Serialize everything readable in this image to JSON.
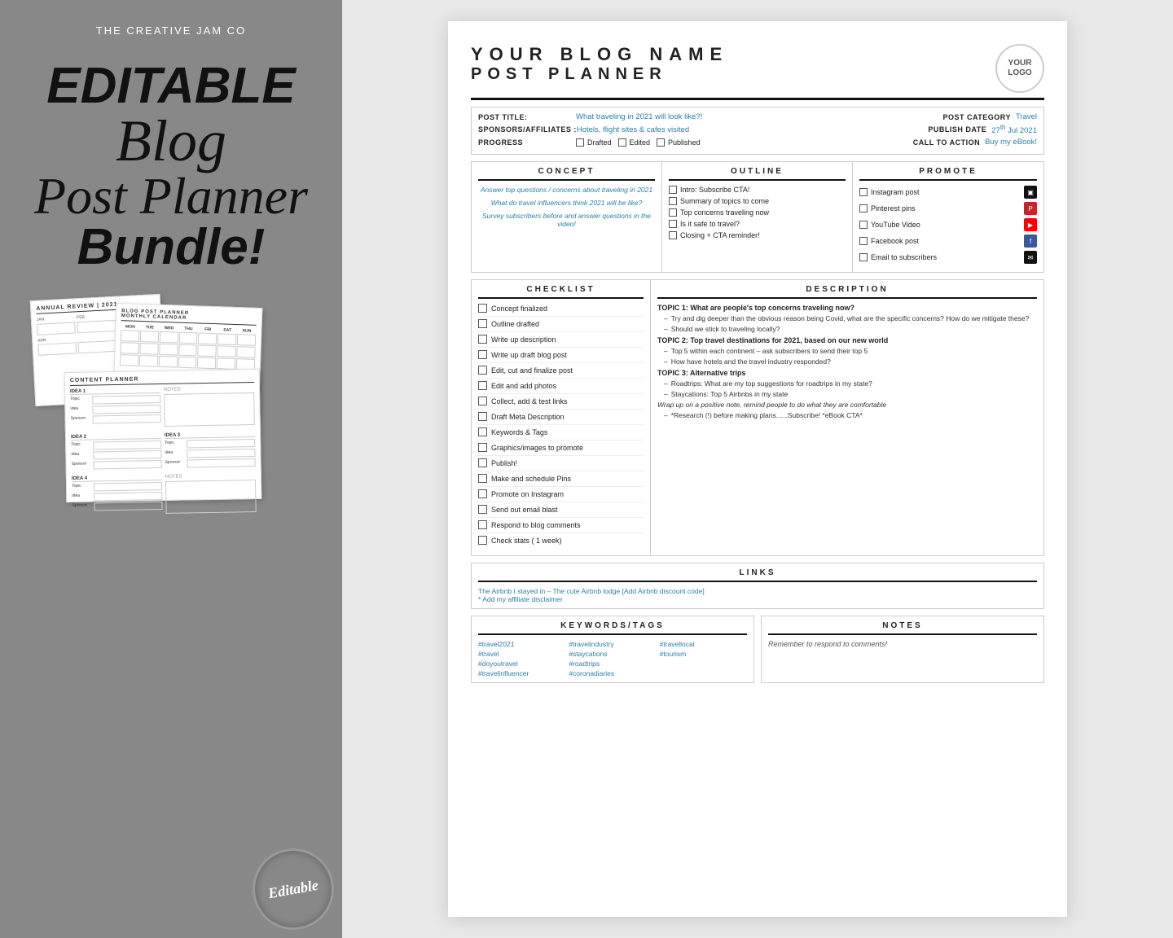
{
  "left": {
    "brand": "THE CREATIVE JAM CO",
    "line1": "EDITABLE",
    "line2": "Blog",
    "line3": "Post Planner",
    "line4": "Bundle!",
    "badge_text": "Editable"
  },
  "planner": {
    "blog_name": "YOUR BLOG NAME",
    "post_planner": "POST PLANNER",
    "logo_text": "YOUR\nLOGO",
    "post_title_label": "POST TITLE:",
    "post_title_value": "What traveling in 2021 will look like?!",
    "sponsors_label": "SPONSORS/AFFILIATES :",
    "sponsors_value": "Hotels, flight sites & cafes visited",
    "progress_label": "PROGRESS",
    "progress_items": [
      "Drafted",
      "Edited",
      "Published"
    ],
    "post_category_label": "POST CATEGORY",
    "post_category_value": "Travel",
    "publish_date_label": "PUBLISH DATE",
    "publish_date_value": "27th Jul 2021",
    "call_to_action_label": "CALL TO ACTION",
    "call_to_action_value": "Buy my eBook!",
    "concept_header": "CONCEPT",
    "concept_items": [
      "Answer top questions / concerns about traveling in 2021",
      "What do travel influencers think 2021 will be like?",
      "Survey subscribers before and answer questions in the video!"
    ],
    "outline_header": "OUTLINE",
    "outline_items": [
      "Intro: Subscribe CTA!",
      "Summary of topics to come",
      "Top concerns traveling now",
      "Is it safe to travel?",
      "Closing + CTA reminder!"
    ],
    "promote_header": "PROMOTE",
    "promote_items": [
      {
        "label": "Instagram post",
        "icon": "▣"
      },
      {
        "label": "Pinterest pins",
        "icon": "P"
      },
      {
        "label": "YouTube Video",
        "icon": "▶"
      },
      {
        "label": "Facebook post",
        "icon": "f"
      },
      {
        "label": "Email to subscribers",
        "icon": "✉"
      }
    ],
    "checklist_header": "CHECKLIST",
    "checklist_items": [
      "Concept finalized",
      "Outline drafted",
      "Write up description",
      "Write up draft blog post",
      "Edit, cut and finalize post",
      "Edit and add photos",
      "Collect, add & test links",
      "Draft Meta Description",
      "Keywords & Tags",
      "Graphics/images to promote",
      "Publish!",
      "Make and schedule Pins",
      "Promote on Instagram",
      "Send out email blast",
      "Respond to blog comments",
      "Check stats ( 1 week)"
    ],
    "description_header": "DESCRIPTION",
    "desc_topic1": "TOPIC 1: What are people's top concerns traveling now?",
    "desc_topic1_bullets": [
      "Try and dig deeper than the obvious reason being Covid, what are the specific concerns? How do we mitigate these?",
      "Should we stick to traveling locally?"
    ],
    "desc_topic2": "TOPIC 2: Top travel destinations for 2021, based on our new world",
    "desc_topic2_bullets": [
      "Top 5 within each continent – ask subscribers to send their top 5",
      "How have hotels and the travel industry responded?"
    ],
    "desc_topic3": "TOPIC 3: Alternative trips",
    "desc_topic3_bullets": [
      "Roadtrips: What are my top suggestions for roadtrips in my state?",
      "Staycations: Top 5 Airbnbs in my state"
    ],
    "desc_wrap": "Wrap up on a positive note, remind people to do what they are comfortable",
    "desc_cta": "– *Research (!) before making plans......Subscribe!  *eBook CTA*",
    "links_header": "LINKS",
    "links_text": "The Airbnb I stayed in – The cute Airbnb lodge [Add Airbnb discount code]\n* Add my affiliate disclaimer",
    "keywords_header": "KEYWORDS/TAGS",
    "keywords": [
      "#travel2021",
      "#travelindustry",
      "#travellocal",
      "#travel",
      "#staycations",
      "#tourism",
      "#doyoutravel",
      "#roadtrips",
      "",
      "#travelinfluencer",
      "#coronadiaries",
      ""
    ],
    "notes_header": "NOTES",
    "notes_text": "Remember to respond to comments!"
  }
}
